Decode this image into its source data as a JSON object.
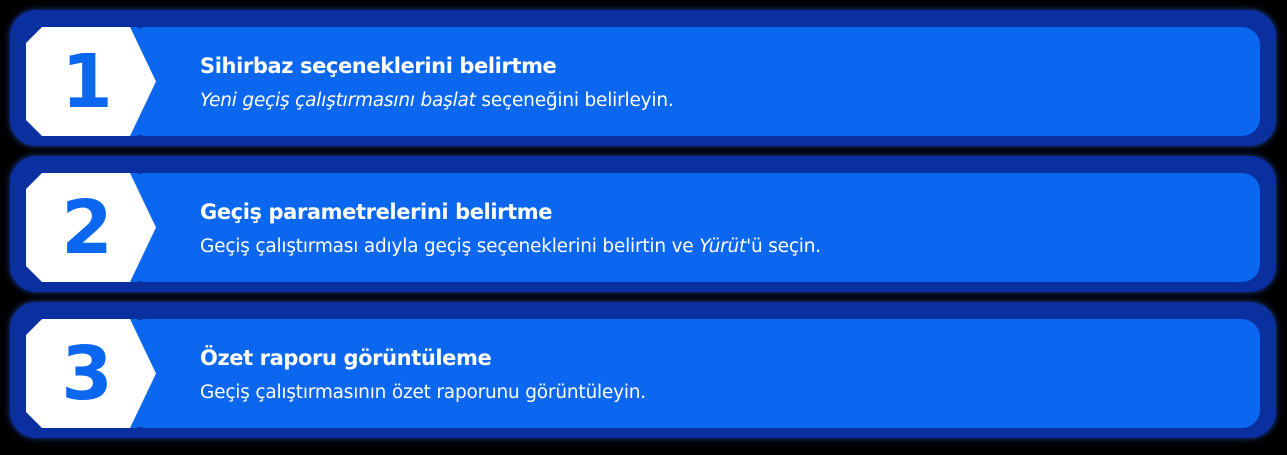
{
  "colors": {
    "background": "#000000",
    "frame": "#0a2f9e",
    "card": "#0b67ef",
    "badge": "#ffffff",
    "number": "#0b67ef",
    "text": "#ffffff"
  },
  "steps": [
    {
      "number": "1",
      "title": "Sihirbaz seçeneklerini belirtme",
      "desc_italic": "Yeni geçiş çalıştırmasını başlat",
      "desc_rest": " seçeneğini belirleyin."
    },
    {
      "number": "2",
      "title": "Geçiş parametrelerini belirtme",
      "desc_prefix": "Geçiş çalıştırması adıyla geçiş seçeneklerini belirtin ve ",
      "desc_italic": "Yürüt",
      "desc_suffix": "'ü seçin."
    },
    {
      "number": "3",
      "title": "Özet raporu görüntüleme",
      "desc": "Geçiş çalıştırmasının özet raporunu görüntüleyin."
    }
  ]
}
